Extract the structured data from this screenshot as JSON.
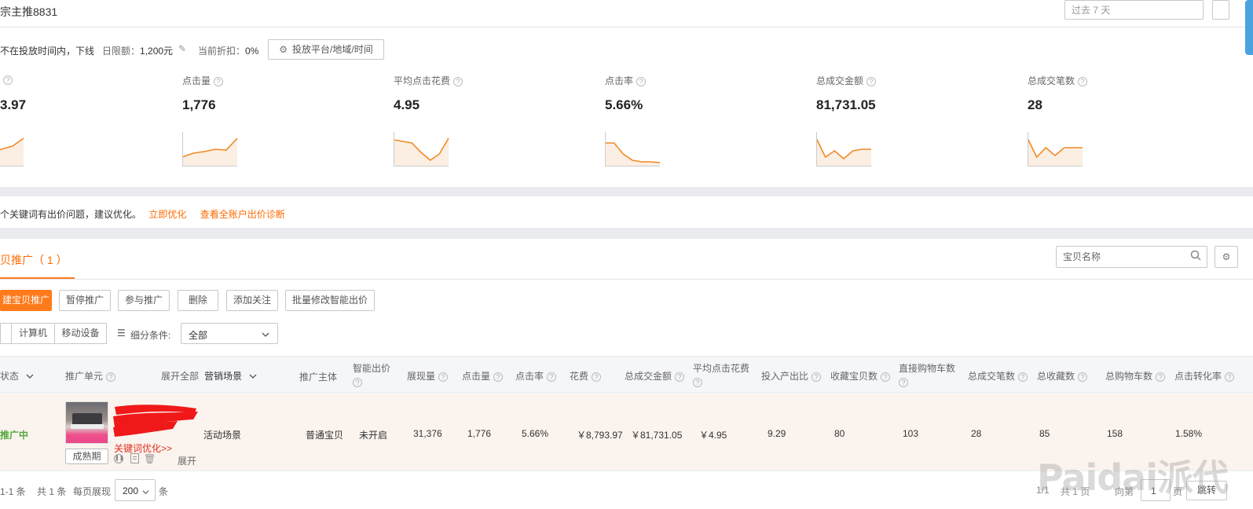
{
  "header": {
    "title": "宗主推8831",
    "date_range": "过去 7 天"
  },
  "status_bar": {
    "status": "不在投放时间内，下线",
    "daily_limit_label": "日限额：",
    "daily_limit_value": "1,200元",
    "discount_label": "当前折扣：",
    "discount_value": "0%",
    "settings_button": "投放平台/地域/时间"
  },
  "metrics": [
    {
      "label": "",
      "value": "3.97",
      "trend": [
        20,
        22,
        24,
        22,
        18,
        8
      ]
    },
    {
      "label": "点击量",
      "value": "1,776",
      "trend": [
        32,
        27,
        25,
        22,
        23,
        8
      ]
    },
    {
      "label": "平均点击花费",
      "value": "4.95",
      "trend": [
        10,
        12,
        14,
        26,
        36,
        28,
        8
      ]
    },
    {
      "label": "点击率",
      "value": "5.66%",
      "trend": [
        14,
        14,
        28,
        36,
        38,
        38,
        39
      ]
    },
    {
      "label": "总成交金额",
      "value": "81,731.05",
      "trend": [
        8,
        32,
        24,
        34,
        24,
        22,
        22
      ]
    },
    {
      "label": "总成交笔数",
      "value": "28",
      "trend": [
        8,
        32,
        20,
        30,
        20,
        20,
        20
      ]
    }
  ],
  "alert": {
    "text": "个关键词有出价问题，建议优化。",
    "optimize_link": "立即优化",
    "diagnose_link": "查看全账户出价诊断"
  },
  "tab": {
    "label": "贝推广（ 1 ）"
  },
  "search": {
    "placeholder": "宝贝名称"
  },
  "toolbar": {
    "new_button": "建宝贝推广",
    "pause_button": "暂停推广",
    "join_button": "参与推广",
    "delete_button": "删除",
    "follow_button": "添加关注",
    "bid_button": "批量修改智能出价"
  },
  "device_filter": {
    "all_label": "",
    "computer_label": "计算机",
    "mobile_label": "移动设备"
  },
  "segment": {
    "label": "细分条件:",
    "selected": "全部"
  },
  "table": {
    "headers": {
      "status": "状态",
      "unit": "推广单元",
      "expand_all": "展开全部",
      "scene": "营销场景",
      "subject": "推广主体",
      "smart_bid": "智能出价",
      "impressions": "展现量",
      "clicks": "点击量",
      "ctr": "点击率",
      "cost": "花费",
      "gmv": "总成交金额",
      "cpc": "平均点击花费",
      "roi": "投入产出比",
      "fav_items": "收藏宝贝数",
      "direct_cart": "直接购物车数",
      "orders": "总成交笔数",
      "fav_total": "总收藏数",
      "cart_total": "总购物车数",
      "cvr": "点击转化率"
    },
    "row": {
      "status": "推广中",
      "keyword_opt": "关键词优化>>",
      "stage": "成熟期",
      "expand": "展开",
      "scene": "活动场景",
      "subject": "普通宝贝",
      "smart_bid": "未开启",
      "impressions": "31,376",
      "clicks": "1,776",
      "ctr": "5.66%",
      "cost": "￥8,793.97",
      "gmv": "￥81,731.05",
      "cpc": "￥4.95",
      "roi": "9.29",
      "fav_items": "80",
      "direct_cart": "103",
      "orders": "28",
      "fav_total": "85",
      "cart_total": "158",
      "cvr": "1.58%"
    }
  },
  "pagination": {
    "range": "1-1 条",
    "total": "共 1 条",
    "per_page_label": "每页展现",
    "per_page_value": "200",
    "unit": "条",
    "page_of": "1/1",
    "total_pages": "共 1 页",
    "goto_label": "向第",
    "goto_value": "1",
    "page_unit": "页",
    "jump_button": "跳转"
  },
  "watermark": "Paidai派代",
  "colors": {
    "accent": "#ff7a1a",
    "status_green": "#52a93b",
    "line": "#f08a24"
  }
}
